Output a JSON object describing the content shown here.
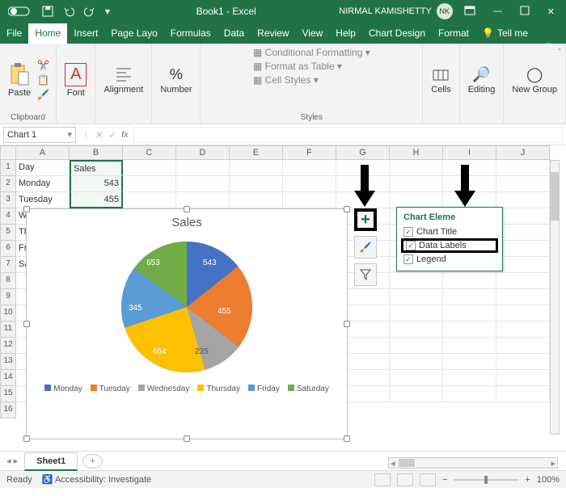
{
  "title": "Book1 - Excel",
  "user": "NIRMAL KAMISHETTY",
  "user_initials": "NK",
  "tabs": [
    "File",
    "Home",
    "Insert",
    "Page Layo",
    "Formulas",
    "Data",
    "Review",
    "View",
    "Help",
    "Chart Design",
    "Format",
    "Tell me"
  ],
  "active_tab": "Home",
  "ribbon": {
    "clipboard": "Clipboard",
    "paste": "Paste",
    "font": "Font",
    "alignment": "Alignment",
    "number": "Number",
    "styles": "Styles",
    "cf": "Conditional Formatting",
    "fat": "Format as Table",
    "cs": "Cell Styles",
    "cells": "Cells",
    "editing": "Editing",
    "newgroup": "New Group"
  },
  "name_box": "Chart 1",
  "columns": [
    "A",
    "B",
    "C",
    "D",
    "E",
    "F",
    "G",
    "H",
    "I",
    "J"
  ],
  "rows": [
    "1",
    "2",
    "3",
    "4",
    "5",
    "6",
    "7",
    "8",
    "9",
    "10",
    "11",
    "12",
    "13",
    "14",
    "15",
    "16"
  ],
  "sheet_data": {
    "A1": "Day",
    "B1": "Sales",
    "A2": "Monday",
    "B2": "543",
    "A3": "Tuesday",
    "B3": "455",
    "A4": "W",
    "A5": "Th",
    "A6": "Fr",
    "A7": "Sa"
  },
  "chart": {
    "title": "Sales",
    "labels": {
      "0": "543",
      "1": "455",
      "2": "235",
      "3": "654",
      "4": "345",
      "5": "653"
    },
    "legend": [
      "Monday",
      "Tuesday",
      "Wednesday",
      "Thursday",
      "Friday",
      "Saturday"
    ]
  },
  "chart_data": {
    "type": "pie",
    "title": "Sales",
    "categories": [
      "Monday",
      "Tuesday",
      "Wednesday",
      "Thursday",
      "Friday",
      "Saturday"
    ],
    "values": [
      543,
      455,
      235,
      654,
      345,
      653
    ],
    "colors": [
      "#4472C4",
      "#ED7D31",
      "#A5A5A5",
      "#FFC000",
      "#5B9BD5",
      "#70AD47"
    ]
  },
  "chart_elements": {
    "heading": "Chart Eleme",
    "items": {
      "0": "Chart Title",
      "1": "Data Labels",
      "2": "Legend"
    }
  },
  "sheet_tab": "Sheet1",
  "status": {
    "ready": "Ready",
    "acc": "Accessibility: Investigate",
    "zoom": "100%"
  }
}
